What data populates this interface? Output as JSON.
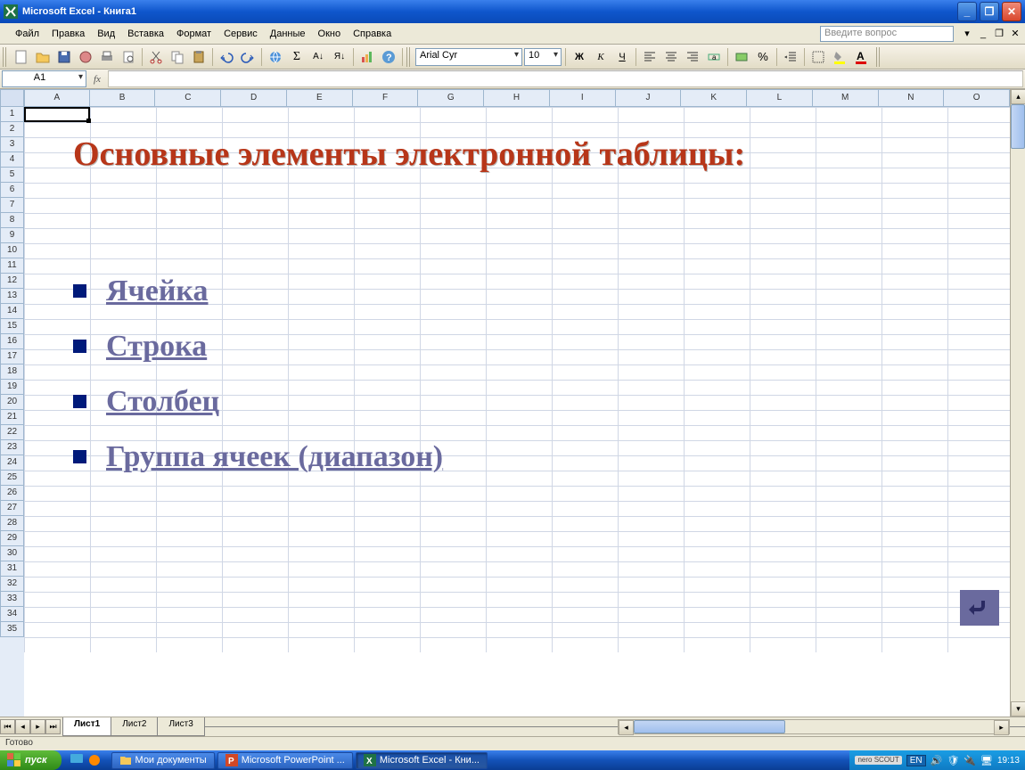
{
  "window": {
    "title": "Microsoft Excel - Книга1",
    "min": "_",
    "max": "❐",
    "close": "✕"
  },
  "menu": {
    "file": "Файл",
    "edit": "Правка",
    "view": "Вид",
    "insert": "Вставка",
    "format": "Формат",
    "tools": "Сервис",
    "data": "Данные",
    "window": "Окно",
    "help": "Справка",
    "question_placeholder": "Введите вопрос",
    "mdi_min": "_",
    "mdi_restore": "❐",
    "mdi_close": "✕"
  },
  "toolbar": {
    "font_name": "Arial Cyr",
    "font_size": "10",
    "bold": "Ж",
    "italic": "К",
    "underline": "Ч"
  },
  "namebox": {
    "cell": "A1",
    "fx": "fx"
  },
  "columns": [
    "A",
    "B",
    "C",
    "D",
    "E",
    "F",
    "G",
    "H",
    "I",
    "J",
    "K",
    "L",
    "M",
    "N",
    "O"
  ],
  "rows": [
    "1",
    "2",
    "3",
    "4",
    "5",
    "6",
    "7",
    "8",
    "9",
    "10",
    "11",
    "12",
    "13",
    "14",
    "15",
    "16",
    "17",
    "18",
    "19",
    "20",
    "21",
    "22",
    "23",
    "24",
    "25",
    "26",
    "27",
    "28",
    "29",
    "30",
    "31",
    "32",
    "33",
    "34",
    "35"
  ],
  "overlay": {
    "title": "Основные элементы электронной таблицы:",
    "items": [
      "Ячейка",
      "Строка",
      "Столбец",
      "Группа ячеек (диапазон)"
    ]
  },
  "sheets": {
    "active": "Лист1",
    "others": [
      "Лист2",
      "Лист3"
    ]
  },
  "status": "Готово",
  "taskbar": {
    "start": "пуск",
    "tasks": [
      {
        "label": "Мои документы"
      },
      {
        "label": "Microsoft PowerPoint ..."
      },
      {
        "label": "Microsoft Excel - Кни...",
        "active": true
      }
    ],
    "nero": "nero SCOUT",
    "lang": "EN",
    "clock": "19:13"
  }
}
